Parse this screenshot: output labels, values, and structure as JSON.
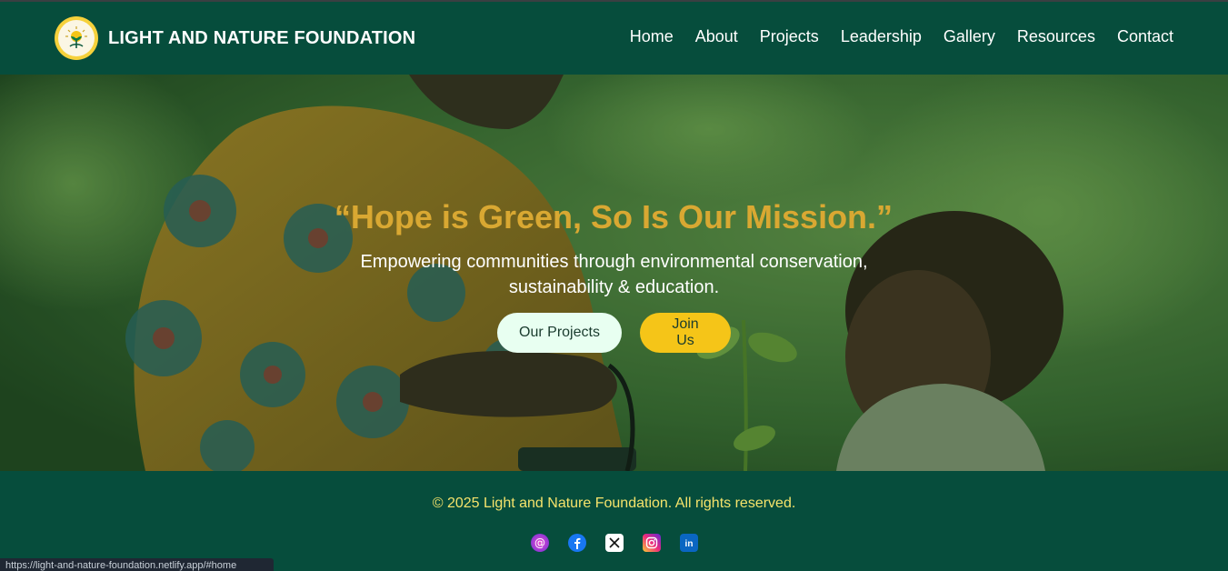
{
  "brand": {
    "name": "LIGHT AND NATURE FOUNDATION"
  },
  "nav": {
    "items": [
      {
        "label": "Home"
      },
      {
        "label": "About"
      },
      {
        "label": "Projects"
      },
      {
        "label": "Leadership"
      },
      {
        "label": "Gallery"
      },
      {
        "label": "Resources"
      },
      {
        "label": "Contact"
      }
    ]
  },
  "hero": {
    "title": "“Hope is Green, So Is Our Mission.”",
    "subtitle": "Empowering communities through environmental conservation, sustainability & education.",
    "buttons": {
      "projects": "Our Projects",
      "join": "Join Us"
    }
  },
  "footer": {
    "copyright": "© 2025 Light and Nature Foundation. All rights reserved.",
    "socials": [
      {
        "icon": "threads-icon"
      },
      {
        "icon": "facebook-icon"
      },
      {
        "icon": "x-icon"
      },
      {
        "icon": "instagram-icon"
      },
      {
        "icon": "linkedin-icon"
      }
    ]
  },
  "status_url": "https://light-and-nature-foundation.netlify.app/#home",
  "colors": {
    "primary": "#064d3c",
    "accent": "#f5c518",
    "title": "#d9a832",
    "copyright": "#f5e36b"
  }
}
